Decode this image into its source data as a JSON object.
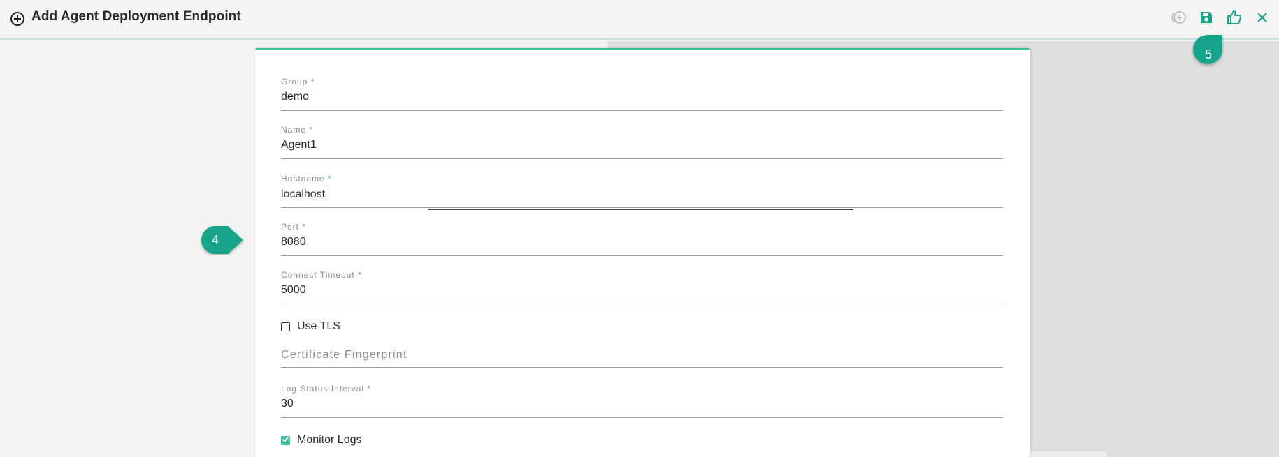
{
  "header": {
    "title": "Add Agent Deployment Endpoint",
    "title_icon": "add-circle-icon",
    "toolbar": [
      {
        "name": "add-another-icon",
        "enabled": false
      },
      {
        "name": "save-icon",
        "enabled": true
      },
      {
        "name": "approve-icon",
        "enabled": true
      },
      {
        "name": "close-icon",
        "enabled": true
      }
    ]
  },
  "form": {
    "group": {
      "label": "Group",
      "required": "*",
      "value": "demo"
    },
    "name": {
      "label": "Name",
      "required": "*",
      "value": "Agent1"
    },
    "hostname": {
      "label": "Hostname",
      "required": "*",
      "value": "localhost"
    },
    "port": {
      "label": "Port",
      "required": "*",
      "value": "8080"
    },
    "connect_timeout": {
      "label": "Connect Timeout",
      "required": "*",
      "value": "5000"
    },
    "use_tls": {
      "label": "Use TLS",
      "checked": false
    },
    "certificate_fingerprint": {
      "placeholder": "Certificate Fingerprint",
      "value": ""
    },
    "log_status_interval": {
      "label": "Log Status Interval",
      "required": "*",
      "value": "30"
    },
    "monitor_logs": {
      "label": "Monitor Logs",
      "checked": true
    }
  },
  "callouts": {
    "step4": "4",
    "step5": "5"
  },
  "colors": {
    "accent": "#3dbf9f",
    "callout": "#17a58a",
    "header_bg": "#f4f4f4",
    "right_pane": "#dedede"
  }
}
